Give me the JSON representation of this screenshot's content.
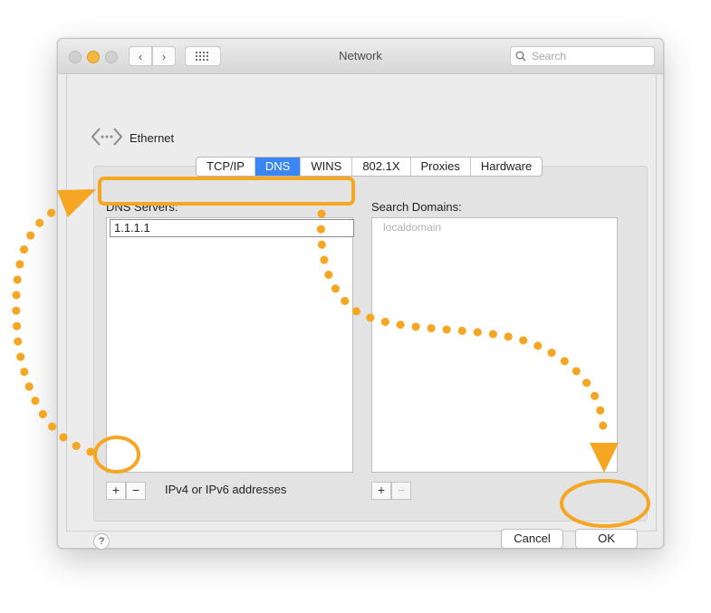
{
  "window": {
    "title": "Network"
  },
  "toolbar": {
    "search_placeholder": "Search"
  },
  "interface": {
    "name": "Ethernet"
  },
  "tabs": [
    {
      "label": "TCP/IP",
      "active": false
    },
    {
      "label": "DNS",
      "active": true
    },
    {
      "label": "WINS",
      "active": false
    },
    {
      "label": "802.1X",
      "active": false
    },
    {
      "label": "Proxies",
      "active": false
    },
    {
      "label": "Hardware",
      "active": false
    }
  ],
  "dns": {
    "servers_label": "DNS Servers:",
    "servers": [
      "1.1.1.1"
    ],
    "hint": "IPv4 or IPv6 addresses"
  },
  "search_domains": {
    "label": "Search Domains:",
    "placeholder_value": "localdomain"
  },
  "controls": {
    "add": "+",
    "remove": "−"
  },
  "buttons": {
    "help": "?",
    "cancel": "Cancel",
    "ok": "OK"
  },
  "colors": {
    "accent": "#3b86f5",
    "annotation": "#f5a623"
  }
}
